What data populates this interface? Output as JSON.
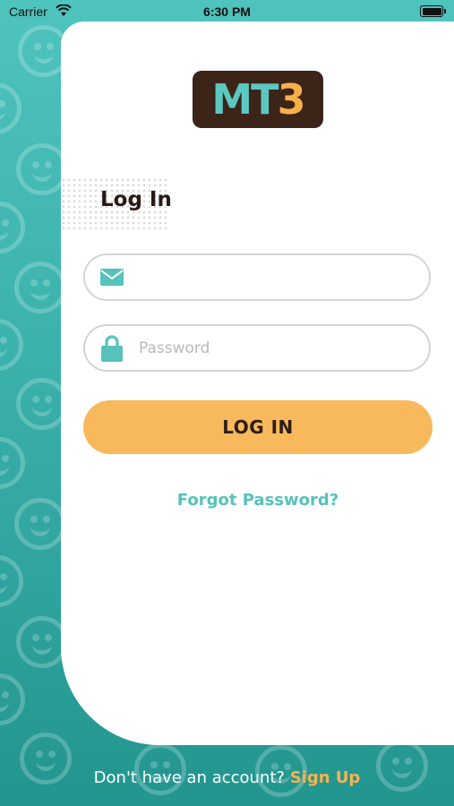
{
  "status_bar": {
    "carrier": "Carrier",
    "time": "6:30 PM",
    "icons": [
      "wifi-icon",
      "battery-icon"
    ]
  },
  "logo": {
    "part1": "MT",
    "part2": "3",
    "colors": {
      "background": "#3d2418",
      "letters": "#5cc8c2",
      "number": "#f5b04a"
    }
  },
  "login": {
    "heading": "Log In",
    "email": {
      "value": "",
      "placeholder": "",
      "icon": "envelope-icon"
    },
    "password": {
      "value": "",
      "placeholder": "Password",
      "icon": "lock-icon"
    },
    "submit_label": "LOG IN",
    "forgot_label": "Forgot Password?"
  },
  "footer": {
    "prompt": "Don't have an account?",
    "signup_label": "Sign Up"
  },
  "colors": {
    "accent_teal": "#4fc3bd",
    "button_orange": "#f8b85c",
    "text_dark": "#2a1a14"
  }
}
